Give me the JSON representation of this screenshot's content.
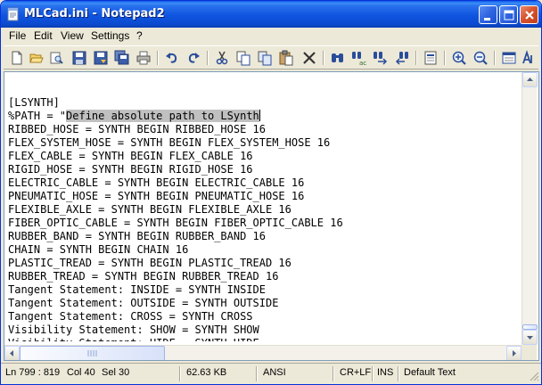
{
  "window": {
    "title": "MLCad.ini - Notepad2"
  },
  "menu": {
    "items": [
      "File",
      "Edit",
      "View",
      "Settings",
      "?"
    ]
  },
  "toolbar": {
    "icons": [
      "new-icon",
      "open-icon",
      "browse-icon",
      "save-icon",
      "save-as-icon",
      "save-copy-icon",
      "print-icon",
      "undo-icon",
      "redo-icon",
      "cut-icon",
      "copy-icon",
      "copy-all-icon",
      "paste-icon",
      "delete-icon",
      "find-icon",
      "replace-icon",
      "find-next-icon",
      "find-previous-icon",
      "goto-icon",
      "zoom-in-icon",
      "zoom-out-icon",
      "schemes-icon",
      "customize-icon"
    ]
  },
  "editor": {
    "lines": [
      "",
      "[LSYNTH]",
      "%PATH = \"",
      "RIBBED_HOSE = SYNTH BEGIN RIBBED_HOSE 16",
      "FLEX_SYSTEM_HOSE = SYNTH BEGIN FLEX_SYSTEM_HOSE 16",
      "FLEX_CABLE = SYNTH BEGIN FLEX_CABLE 16",
      "RIGID_HOSE = SYNTH BEGIN RIGID_HOSE 16",
      "ELECTRIC_CABLE = SYNTH BEGIN ELECTRIC_CABLE 16",
      "PNEUMATIC_HOSE = SYNTH BEGIN PNEUMATIC_HOSE 16",
      "FLEXIBLE_AXLE = SYNTH BEGIN FLEXIBLE_AXLE 16",
      "FIBER_OPTIC_CABLE = SYNTH BEGIN FIBER_OPTIC_CABLE 16",
      "RUBBER_BAND = SYNTH BEGIN RUBBER_BAND 16",
      "CHAIN = SYNTH BEGIN CHAIN 16",
      "PLASTIC_TREAD = SYNTH BEGIN PLASTIC_TREAD 16",
      "RUBBER_TREAD = SYNTH BEGIN RUBBER_TREAD 16",
      "Tangent Statement: INSIDE = SYNTH INSIDE",
      "Tangent Statement: OUTSIDE = SYNTH OUTSIDE",
      "Tangent Statement: CROSS = SYNTH CROSS",
      "Visibility Statement: SHOW = SYNTH SHOW",
      "Visibility Statement: HIDE = SYNTH HIDE"
    ],
    "selected_text": "Define absolute path to LSynth",
    "selection_line": 2
  },
  "status": {
    "position": "Ln 799 : 819",
    "column": "Col 40",
    "selection": "Sel 30",
    "size": "62.63 KB",
    "encoding": "ANSI",
    "line_endings": "CR+LF",
    "insert_mode": "INS",
    "scheme": "Default Text"
  },
  "colors": {
    "selection": "#c0c0c0",
    "title_bar": "#0c4bd1"
  }
}
